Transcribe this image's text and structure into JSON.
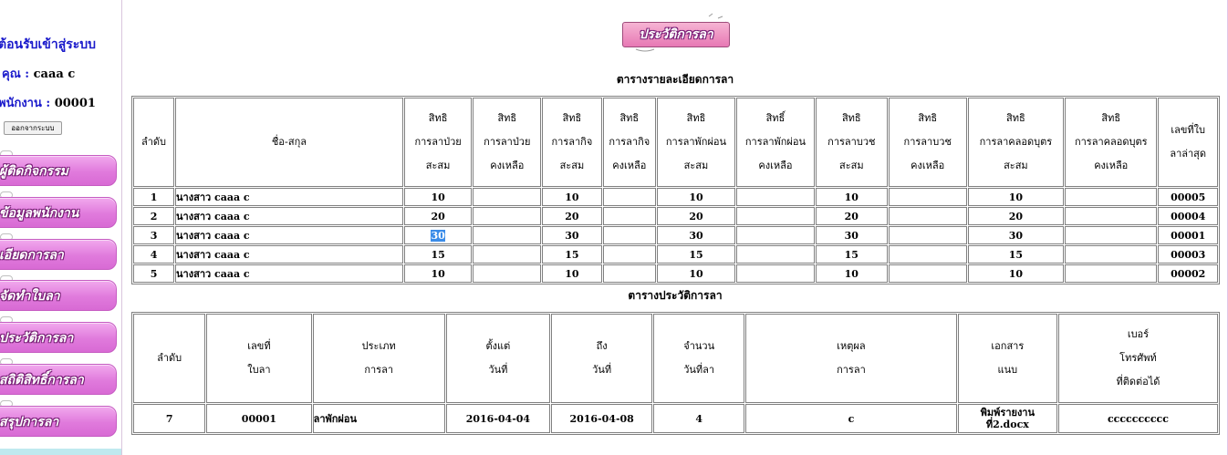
{
  "sidebar": {
    "welcome": "ต้อนรับเข้าสู่ระบบ",
    "user_label": "คุณ :",
    "user_name": "caaa c",
    "employee_label": "พนักงาน :",
    "employee_id": "00001",
    "logout_label": "ออกจากระบบ",
    "menu": [
      {
        "label": "ผู้ติดกิจกรรม"
      },
      {
        "label": "ข้อมูลพนักงาน"
      },
      {
        "label": "เอียดการลา"
      },
      {
        "label": "จัดทำใบลา"
      },
      {
        "label": "ประวัติการลา"
      },
      {
        "label": "สถิติสิทธิ์การลา"
      },
      {
        "label": "สรุปการลา"
      }
    ]
  },
  "banner": {
    "label": "ประวัติการลา"
  },
  "detail": {
    "title": "ตารางรายละเอียดการลา",
    "headers": [
      [
        "ลำดับ"
      ],
      [
        "ชื่อ-สกุล"
      ],
      [
        "สิทธิ",
        "การลาป่วย",
        "สะสม"
      ],
      [
        "สิทธิ",
        "การลาป่วย",
        "คงเหลือ"
      ],
      [
        "สิทธิ",
        "การลากิจ",
        "สะสม"
      ],
      [
        "สิทธิ",
        "การลากิจ",
        "คงเหลือ"
      ],
      [
        "สิทธิ",
        "การลาพักผ่อน",
        "สะสม"
      ],
      [
        "สิทธิ์",
        "การลาพักผ่อน",
        "คงเหลือ"
      ],
      [
        "สิทธิ",
        "การลาบวช",
        "สะสม"
      ],
      [
        "สิทธิ",
        "การลาบวช",
        "คงเหลือ"
      ],
      [
        "สิทธิ",
        "การลาคลอดบุตร",
        "สะสม"
      ],
      [
        "สิทธิ",
        "การลาคลอดบุตร",
        "คงเหลือ"
      ],
      [
        "เลขที่ใบ",
        "ลาล่าสุด"
      ]
    ],
    "rows": [
      [
        "1",
        "นางสาว  caaa  c",
        "10",
        "",
        "10",
        "",
        "10",
        "",
        "10",
        "",
        "10",
        "",
        "00005"
      ],
      [
        "2",
        "นางสาว  caaa  c",
        "20",
        "",
        "20",
        "",
        "20",
        "",
        "20",
        "",
        "20",
        "",
        "00004"
      ],
      [
        "3",
        "นางสาว  caaa  c",
        "30",
        "",
        "30",
        "",
        "30",
        "",
        "30",
        "",
        "30",
        "",
        "00001"
      ],
      [
        "4",
        "นางสาว  caaa  c",
        "15",
        "",
        "15",
        "",
        "15",
        "",
        "15",
        "",
        "15",
        "",
        "00003"
      ],
      [
        "5",
        "นางสาว  caaa  c",
        "10",
        "",
        "10",
        "",
        "10",
        "",
        "10",
        "",
        "10",
        "",
        "00002"
      ]
    ]
  },
  "history": {
    "title": "ตารางประวัติการลา",
    "headers": [
      [
        "ลำดับ"
      ],
      [
        "เลขที่",
        "ใบลา"
      ],
      [
        "ประเภท",
        "การลา"
      ],
      [
        "ตั้งแต่",
        "วันที่"
      ],
      [
        "ถึง",
        "วันที่"
      ],
      [
        "จำนวน",
        "วันที่ลา"
      ],
      [
        "เหตุผล",
        "การลา"
      ],
      [
        "เอกสาร",
        "แนบ"
      ],
      [
        "เบอร์",
        "โทรศัพท์",
        "ที่ติดต่อได้"
      ]
    ],
    "rows": [
      [
        "7",
        "00001",
        "ลาพักผ่อน",
        "2016-04-04",
        "2016-04-08",
        "4",
        "c",
        "พิมพ์รายงาน ที่2.docx",
        "cccccccccc"
      ]
    ]
  },
  "colors": {
    "menu_pink": "#e07adc",
    "accent_blue": "#1a1acb",
    "selection": "#3b8ce8"
  }
}
